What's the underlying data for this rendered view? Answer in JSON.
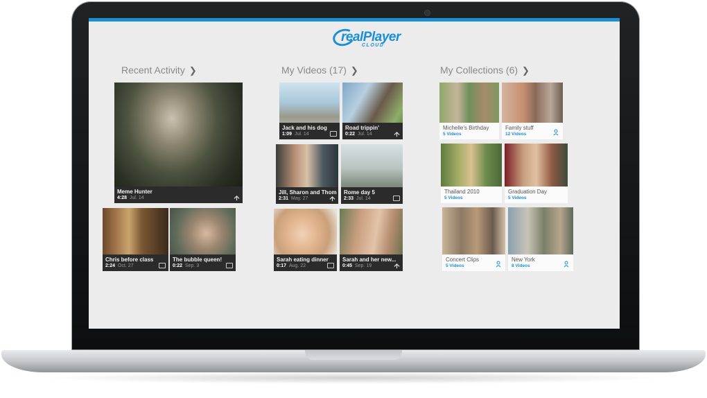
{
  "app": {
    "logo_text": "realPlayer",
    "logo_sub": "CLOUD",
    "accent": "#1a8fd8"
  },
  "sections": {
    "recent": {
      "label": "Recent Activity"
    },
    "videos": {
      "label": "My Videos (17)"
    },
    "collections": {
      "label": "My Collections (6)"
    }
  },
  "recent": [
    {
      "title": "Meme Hunter",
      "duration": "4:28",
      "date": "Jul. 14",
      "icon": "share-icon"
    },
    {
      "title": "Chris before class",
      "duration": "2:24",
      "date": "Oct. 27",
      "icon": "film-icon"
    },
    {
      "title": "The bubble queen!",
      "duration": "0:22",
      "date": "Sep. 3",
      "icon": "film-icon"
    }
  ],
  "videos": [
    {
      "title": "Jack and his dog",
      "duration": "1:09",
      "date": "Jul. 14",
      "icon": "film-icon"
    },
    {
      "title": "Road trippin'",
      "duration": "0:22",
      "date": "Jul. 14",
      "icon": "share-icon"
    },
    {
      "title": "Jill, Sharon and Thom",
      "duration": "2:31",
      "date": "May. 27",
      "icon": "share-icon"
    },
    {
      "title": "Rome day 5",
      "duration": "2:33",
      "date": "Jul. 14",
      "icon": "film-icon"
    },
    {
      "title": "Sarah eating dinner",
      "duration": "0:17",
      "date": "Aug. 22",
      "icon": "film-icon"
    },
    {
      "title": "Sarah and her new...",
      "duration": "0:45",
      "date": "Sep. 19",
      "icon": "share-icon"
    }
  ],
  "collections": [
    {
      "title": "Michelle's Birthday",
      "count": "5 Videos"
    },
    {
      "title": "Family stuff",
      "count": "12 Videos"
    },
    {
      "title": "Thailand 2010",
      "count": "5 Videos"
    },
    {
      "title": "Graduation Day",
      "count": "5 Videos"
    },
    {
      "title": "Concert Clips",
      "count": "5 Videos"
    },
    {
      "title": "New York",
      "count": "8 Videos"
    }
  ]
}
